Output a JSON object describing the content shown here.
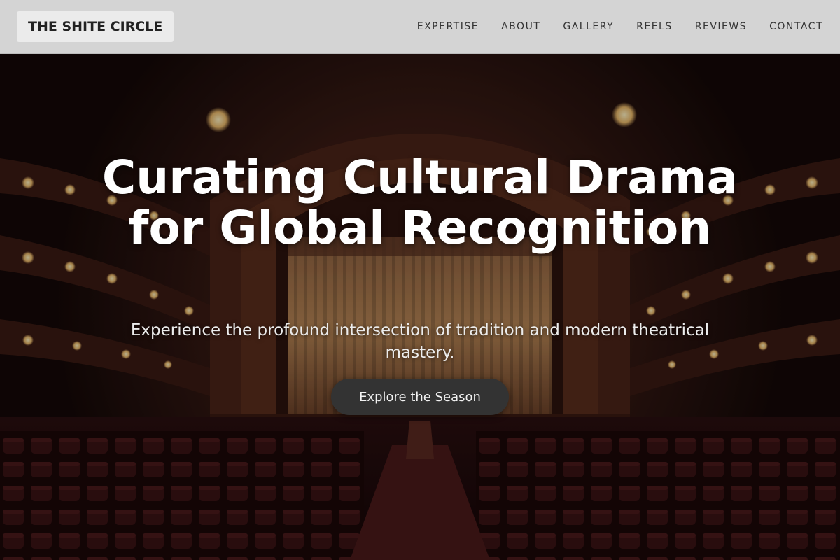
{
  "brand": {
    "logo_text": "THE SHITE CIRCLE"
  },
  "nav": {
    "items": [
      {
        "label": "EXPERTISE"
      },
      {
        "label": "ABOUT"
      },
      {
        "label": "GALLERY"
      },
      {
        "label": "REELS"
      },
      {
        "label": "REVIEWS"
      },
      {
        "label": "CONTACT"
      }
    ]
  },
  "hero": {
    "headline": "Curating Cultural Drama for Global Recognition",
    "subheadline": "Experience the profound intersection of tradition and modern theatrical mastery.",
    "cta_label": "Explore the Season",
    "background_image": "theatre-auditorium-with-stage-curtain"
  },
  "colors": {
    "header_bg": "#d4d4d4",
    "logo_bg": "#ebebeb",
    "nav_text": "#333333",
    "headline_text": "#ffffff",
    "cta_bg": "#333333",
    "cta_text": "#f2f2f2"
  }
}
